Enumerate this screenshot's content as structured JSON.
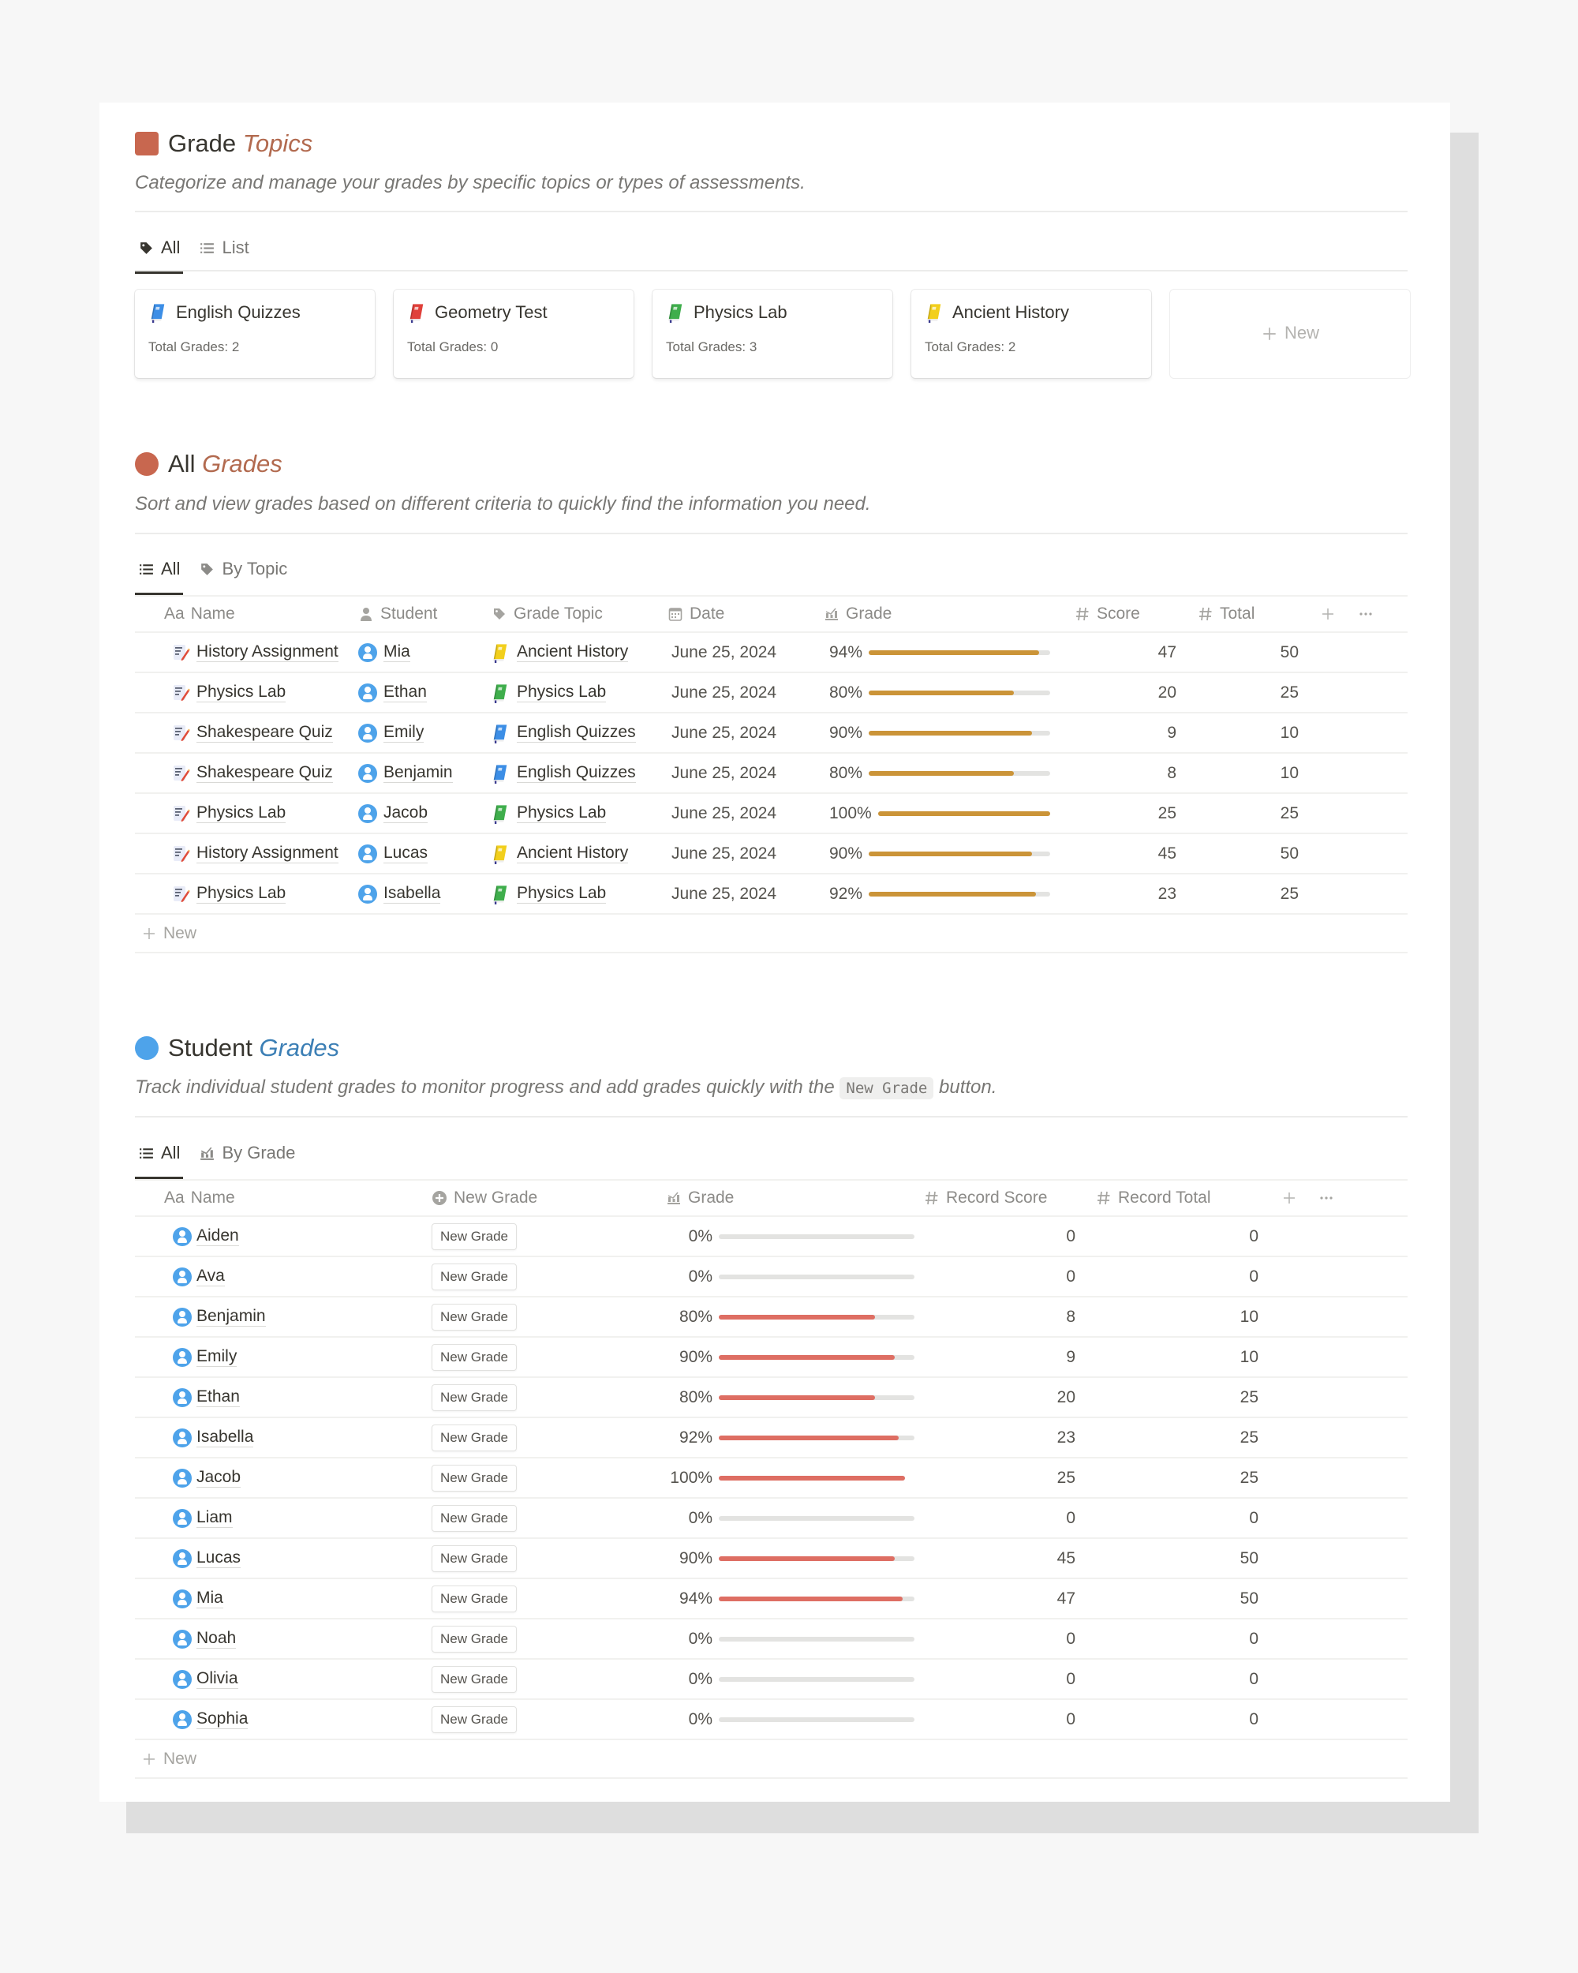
{
  "colors": {
    "accent_brown": "#c8674f",
    "accent_blue": "#4ea3ea",
    "bar_gold": "#cb9438",
    "bar_red": "#de6e63",
    "book_blue": "#3c8ee6",
    "book_red": "#e0403a",
    "book_green": "#3fae4c",
    "book_yellow": "#f2cf1c"
  },
  "grade_topics": {
    "title_plain": "Grade",
    "title_accent": "Topics",
    "icon": "square-icon",
    "subtitle": "Categorize and manage your grades by specific topics or types of assessments.",
    "tabs": [
      {
        "label": "All",
        "icon": "tag-icon",
        "active": true
      },
      {
        "label": "List",
        "icon": "list-icon",
        "active": false
      }
    ],
    "cards": [
      {
        "title": "English Quizzes",
        "icon": "blue-book-icon",
        "color": "#3c8ee6",
        "stat": "Total Grades: 2"
      },
      {
        "title": "Geometry Test",
        "icon": "red-book-icon",
        "color": "#e0403a",
        "stat": "Total Grades: 0"
      },
      {
        "title": "Physics Lab",
        "icon": "green-book-icon",
        "color": "#3fae4c",
        "stat": "Total Grades: 3"
      },
      {
        "title": "Ancient History",
        "icon": "yellow-book-icon",
        "color": "#f2cf1c",
        "stat": "Total Grades: 2"
      }
    ],
    "new_card_label": "New"
  },
  "all_grades": {
    "title_plain": "All",
    "title_accent": "Grades",
    "icon": "circle-icon",
    "subtitle": "Sort and view grades based on different criteria to quickly find the information you need.",
    "tabs": [
      {
        "label": "All",
        "icon": "list-icon",
        "active": true
      },
      {
        "label": "By Topic",
        "icon": "tag-icon",
        "active": false
      }
    ],
    "columns": {
      "name": "Name",
      "name_prefix": "Aa",
      "student": "Student",
      "topic": "Grade Topic",
      "date": "Date",
      "grade": "Grade",
      "score": "Score",
      "total": "Total",
      "add": "+",
      "more": "···"
    },
    "rows": [
      {
        "name": "History Assignment",
        "student": "Mia",
        "topic": "Ancient History",
        "topic_color": "#f2cf1c",
        "date": "June 25, 2024",
        "grade": "94%",
        "grade_value": 0.94,
        "score": "47",
        "total": "50"
      },
      {
        "name": "Physics Lab",
        "student": "Ethan",
        "topic": "Physics Lab",
        "topic_color": "#3fae4c",
        "date": "June 25, 2024",
        "grade": "80%",
        "grade_value": 0.8,
        "score": "20",
        "total": "25"
      },
      {
        "name": "Shakespeare Quiz",
        "student": "Emily",
        "topic": "English Quizzes",
        "topic_color": "#3c8ee6",
        "date": "June 25, 2024",
        "grade": "90%",
        "grade_value": 0.9,
        "score": "9",
        "total": "10"
      },
      {
        "name": "Shakespeare Quiz",
        "student": "Benjamin",
        "topic": "English Quizzes",
        "topic_color": "#3c8ee6",
        "date": "June 25, 2024",
        "grade": "80%",
        "grade_value": 0.8,
        "score": "8",
        "total": "10"
      },
      {
        "name": "Physics Lab",
        "student": "Jacob",
        "topic": "Physics Lab",
        "topic_color": "#3fae4c",
        "date": "June 25, 2024",
        "grade": "100%",
        "grade_value": 1.0,
        "score": "25",
        "total": "25"
      },
      {
        "name": "History Assignment",
        "student": "Lucas",
        "topic": "Ancient History",
        "topic_color": "#f2cf1c",
        "date": "June 25, 2024",
        "grade": "90%",
        "grade_value": 0.9,
        "score": "45",
        "total": "50"
      },
      {
        "name": "Physics Lab",
        "student": "Isabella",
        "topic": "Physics Lab",
        "topic_color": "#3fae4c",
        "date": "June 25, 2024",
        "grade": "92%",
        "grade_value": 0.92,
        "score": "23",
        "total": "25"
      }
    ],
    "new_row_label": "New"
  },
  "student_grades": {
    "title_plain": "Student",
    "title_accent": "Grades",
    "icon": "circle-icon",
    "subtitle_before": "Track individual student grades to monitor progress and add grades quickly with the",
    "subtitle_code": "New Grade",
    "subtitle_after": "button.",
    "tabs": [
      {
        "label": "All",
        "icon": "list-icon",
        "active": true
      },
      {
        "label": "By Grade",
        "icon": "chart-icon",
        "active": false
      }
    ],
    "columns": {
      "name": "Name",
      "name_prefix": "Aa",
      "new_grade": "New Grade",
      "grade": "Grade",
      "record_score": "Record Score",
      "record_total": "Record Total",
      "add": "+",
      "more": "···"
    },
    "button_label": "New Grade",
    "rows": [
      {
        "name": "Aiden",
        "grade": "0%",
        "grade_value": 0,
        "score": "0",
        "total": "0"
      },
      {
        "name": "Ava",
        "grade": "0%",
        "grade_value": 0,
        "score": "0",
        "total": "0"
      },
      {
        "name": "Benjamin",
        "grade": "80%",
        "grade_value": 0.8,
        "score": "8",
        "total": "10"
      },
      {
        "name": "Emily",
        "grade": "90%",
        "grade_value": 0.9,
        "score": "9",
        "total": "10"
      },
      {
        "name": "Ethan",
        "grade": "80%",
        "grade_value": 0.8,
        "score": "20",
        "total": "25"
      },
      {
        "name": "Isabella",
        "grade": "92%",
        "grade_value": 0.92,
        "score": "23",
        "total": "25"
      },
      {
        "name": "Jacob",
        "grade": "100%",
        "grade_value": 1.0,
        "score": "25",
        "total": "25"
      },
      {
        "name": "Liam",
        "grade": "0%",
        "grade_value": 0,
        "score": "0",
        "total": "0"
      },
      {
        "name": "Lucas",
        "grade": "90%",
        "grade_value": 0.9,
        "score": "45",
        "total": "50"
      },
      {
        "name": "Mia",
        "grade": "94%",
        "grade_value": 0.94,
        "score": "47",
        "total": "50"
      },
      {
        "name": "Noah",
        "grade": "0%",
        "grade_value": 0,
        "score": "0",
        "total": "0"
      },
      {
        "name": "Olivia",
        "grade": "0%",
        "grade_value": 0,
        "score": "0",
        "total": "0"
      },
      {
        "name": "Sophia",
        "grade": "0%",
        "grade_value": 0,
        "score": "0",
        "total": "0"
      }
    ],
    "new_row_label": "New"
  }
}
